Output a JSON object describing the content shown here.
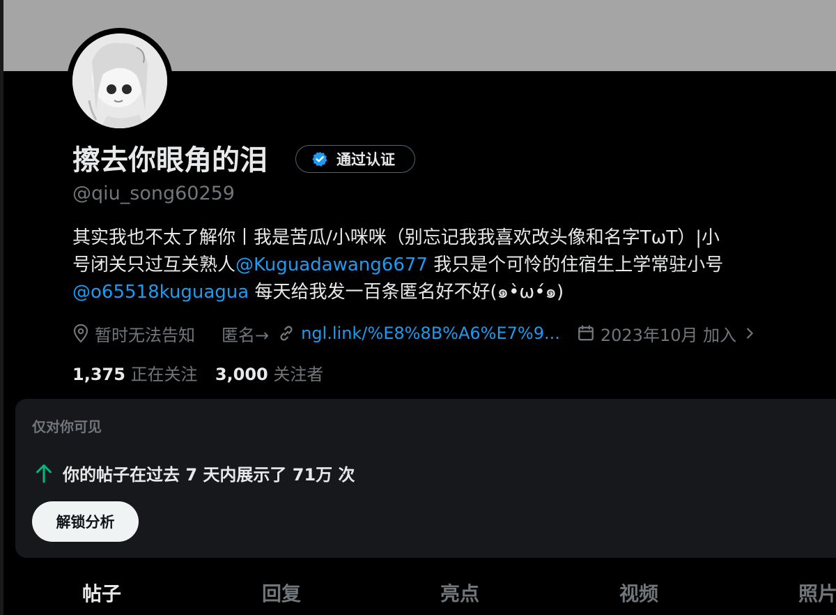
{
  "profile": {
    "display_name": "擦去你眼角的泪",
    "verified_label": "通过认证",
    "handle": "@qiu_song60259",
    "bio": {
      "line1": "其实我也不太了解你丨我是苦瓜/小咪咪（别忘记我我喜欢改头像和名字TωT）|小",
      "line2_text": "号闭关只过互关熟人",
      "line2_mention": "@Kuguadawang6677",
      "line2_tail": " 我只是个可怜的住宿生上学常驻小号",
      "line3_mention": "@o65518kuguagua",
      "line3_tail": " 每天给我发一百条匿名好不好(๑•̀ω•́๑)"
    },
    "meta": {
      "location": "暂时无法告知",
      "anon_text": "匿名→",
      "link": "ngl.link/%E8%8B%A6%E7%9...",
      "joined": "2023年10月 加入"
    },
    "following_count": "1,375",
    "following_label": "正在关注",
    "followers_count": "3,000",
    "followers_label": "关注者"
  },
  "private_card": {
    "title": "仅对你可见",
    "stat_text": "你的帖子在过去 7 天内展示了 71万 次",
    "button_label": "解锁分析"
  },
  "tabs": [
    {
      "label": "帖子",
      "active": true
    },
    {
      "label": "回复",
      "active": false
    },
    {
      "label": "亮点",
      "active": false
    },
    {
      "label": "视频",
      "active": false
    },
    {
      "label": "照片",
      "active": false
    }
  ],
  "colors": {
    "background": "#000000",
    "banner": "#a5a5a5",
    "accent_blue": "#1d9bf0",
    "secondary_text": "#71767b",
    "trend_green": "#00ba7c"
  },
  "icons": {
    "verified": "verified-badge-icon",
    "location": "location-pin-icon",
    "link": "link-icon",
    "calendar": "calendar-icon",
    "chevron": "chevron-right-icon",
    "trend": "arrow-up-icon"
  }
}
